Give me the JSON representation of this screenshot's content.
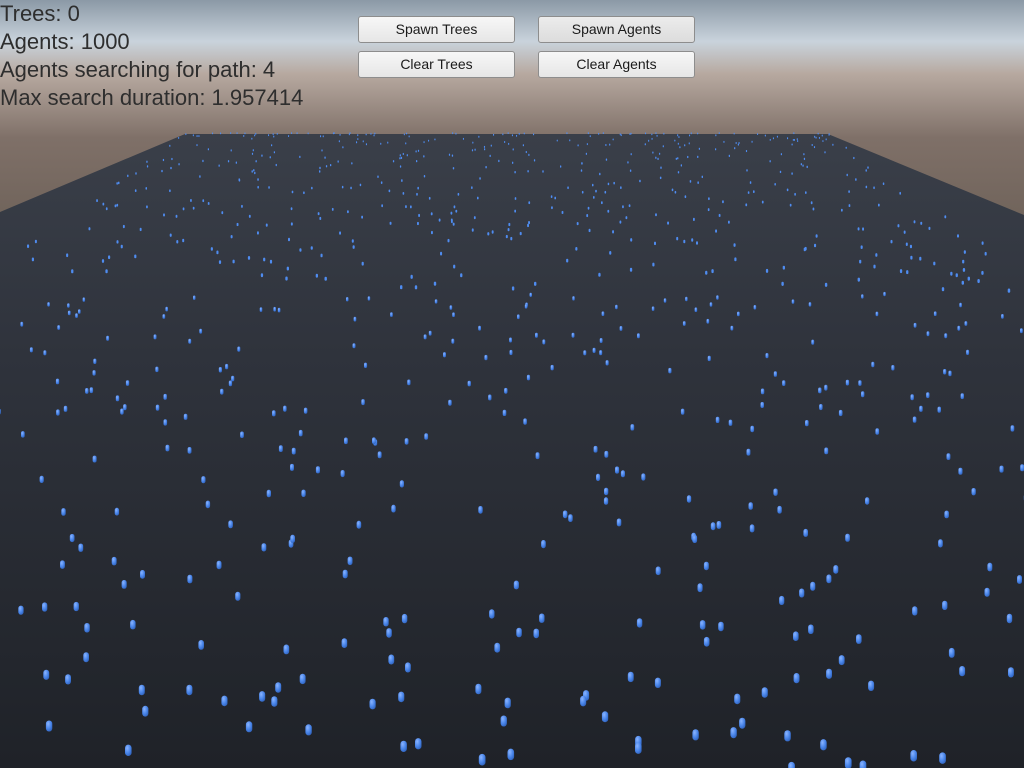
{
  "hud": {
    "trees": "Trees: 0",
    "agents": "Agents: 1000",
    "searching": "Agents searching for path: 4",
    "max_duration": "Max search duration: 1.957414"
  },
  "buttons": {
    "spawn_trees": "Spawn Trees",
    "spawn_agents": "Spawn Agents",
    "clear_trees": "Clear Trees",
    "clear_agents": "Clear Agents"
  },
  "scene": {
    "agent_count": 1000,
    "agent_color": "#4f8cf0",
    "ground_color": "#2a2e36",
    "sky_color": "#b9c7d6",
    "horizon_color": "#7a6c62"
  }
}
